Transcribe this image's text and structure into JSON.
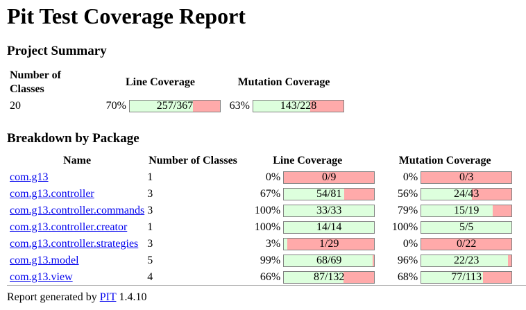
{
  "title": "Pit Test Coverage Report",
  "summary": {
    "heading": "Project Summary",
    "headers": [
      "Number of Classes",
      "Line Coverage",
      "Mutation Coverage"
    ],
    "classes": "20",
    "line_pct": "70%",
    "line_fraction": "257/367",
    "line_ratio": 0.7003,
    "mut_pct": "63%",
    "mut_fraction": "143/228",
    "mut_ratio": 0.6272
  },
  "breakdown": {
    "heading": "Breakdown by Package",
    "headers": [
      "Name",
      "Number of Classes",
      "Line Coverage",
      "Mutation Coverage"
    ],
    "rows": [
      {
        "name": "com.g13",
        "classes": "1",
        "line_pct": "0%",
        "line_fraction": "0/9",
        "line_ratio": 0.0,
        "mut_pct": "0%",
        "mut_fraction": "0/3",
        "mut_ratio": 0.0
      },
      {
        "name": "com.g13.controller",
        "classes": "3",
        "line_pct": "67%",
        "line_fraction": "54/81",
        "line_ratio": 0.667,
        "mut_pct": "56%",
        "mut_fraction": "24/43",
        "mut_ratio": 0.558
      },
      {
        "name": "com.g13.controller.commands",
        "classes": "3",
        "line_pct": "100%",
        "line_fraction": "33/33",
        "line_ratio": 1.0,
        "mut_pct": "79%",
        "mut_fraction": "15/19",
        "mut_ratio": 0.789
      },
      {
        "name": "com.g13.controller.creator",
        "classes": "1",
        "line_pct": "100%",
        "line_fraction": "14/14",
        "line_ratio": 1.0,
        "mut_pct": "100%",
        "mut_fraction": "5/5",
        "mut_ratio": 1.0
      },
      {
        "name": "com.g13.controller.strategies",
        "classes": "3",
        "line_pct": "3%",
        "line_fraction": "1/29",
        "line_ratio": 0.034,
        "mut_pct": "0%",
        "mut_fraction": "0/22",
        "mut_ratio": 0.0
      },
      {
        "name": "com.g13.model",
        "classes": "5",
        "line_pct": "99%",
        "line_fraction": "68/69",
        "line_ratio": 0.986,
        "mut_pct": "96%",
        "mut_fraction": "22/23",
        "mut_ratio": 0.957
      },
      {
        "name": "com.g13.view",
        "classes": "4",
        "line_pct": "66%",
        "line_fraction": "87/132",
        "line_ratio": 0.659,
        "mut_pct": "68%",
        "mut_fraction": "77/113",
        "mut_ratio": 0.681
      }
    ]
  },
  "footer": {
    "prefix": "Report generated by ",
    "link": "PIT",
    "version": " 1.4.10"
  },
  "colors": {
    "covered": "#ddffdd",
    "uncovered": "#ffaaaa",
    "link": "#0000ee"
  }
}
